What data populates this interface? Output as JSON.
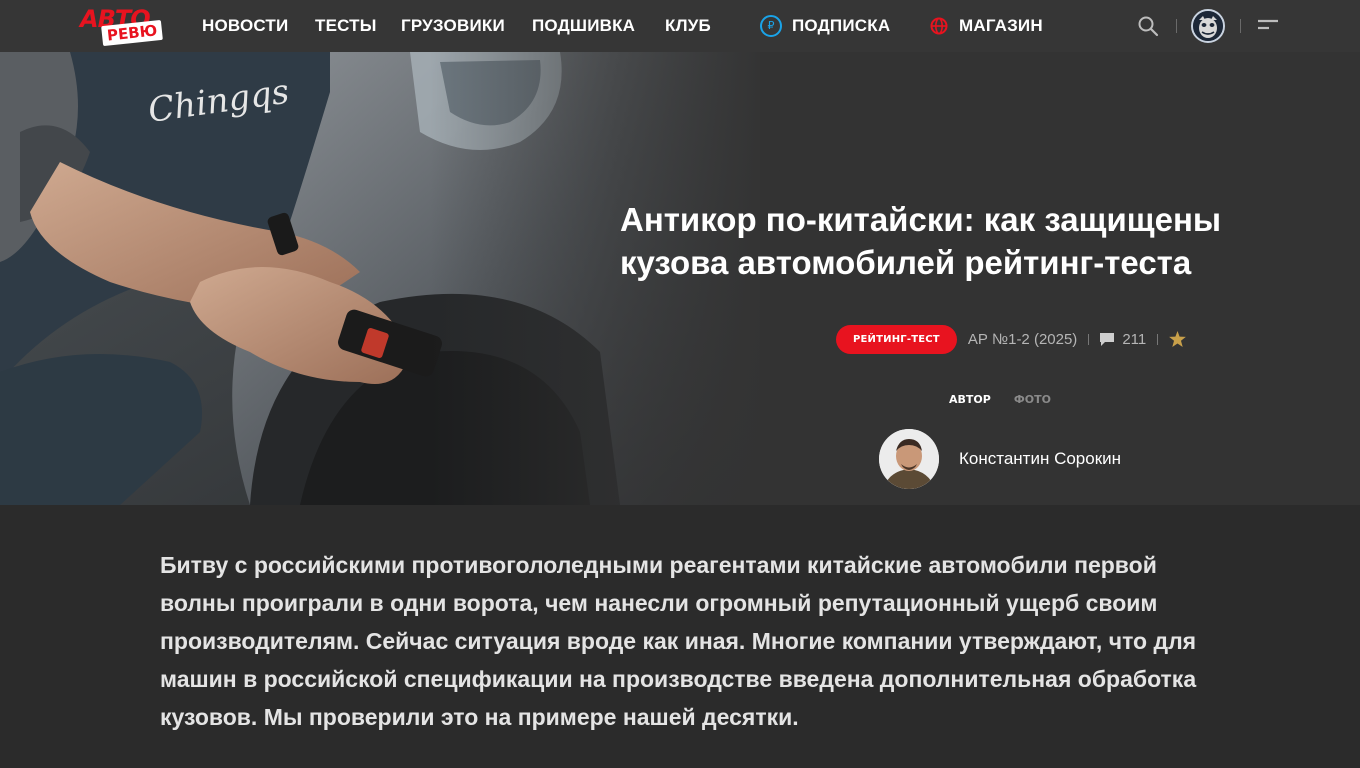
{
  "brand": {
    "logo_top": "АВТО",
    "logo_bottom": "РЕВЮ"
  },
  "nav": {
    "items": [
      "НОВОСТИ",
      "ТЕСТЫ",
      "ГРУЗОВИКИ",
      "ПОДШИВКА",
      "КЛУБ"
    ],
    "subscription": "ПОДПИСКА",
    "shop": "МАГАЗИН"
  },
  "colors": {
    "accent": "#e8131f",
    "subscription_icon": "#1aa3e8",
    "background": "#2b2b2b",
    "header": "#363636"
  },
  "icons": {
    "search": "search-icon",
    "menu": "menu-icon",
    "user": "user-avatar",
    "comments": "comment-icon",
    "favorite": "star-icon"
  },
  "article": {
    "title": "Антикор по-китайски: как защищены кузова автомобилей рейтинг-теста",
    "badge": "РЕЙТИНГ-ТЕСТ",
    "issue": "АР №1-2 (2025)",
    "comments_count": "211",
    "roles": {
      "author": "АВТОР",
      "photo": "ФОТО"
    },
    "author_name": "Константин Сорокин",
    "lead": "Битву с российскими противогололедными реагентами китайские автомобили первой волны проиграли в одни ворота, чем нанесли огромный репутационный ущерб своим производителям. Сейчас ситуация вроде как иная. Многие компании утверждают, что для машин в российской спецификации на производстве введена дополнительная обработка кузовов. Мы проверили это на примере нашей десятки."
  },
  "hero_image": {
    "shirt_text": "Chingqs"
  }
}
